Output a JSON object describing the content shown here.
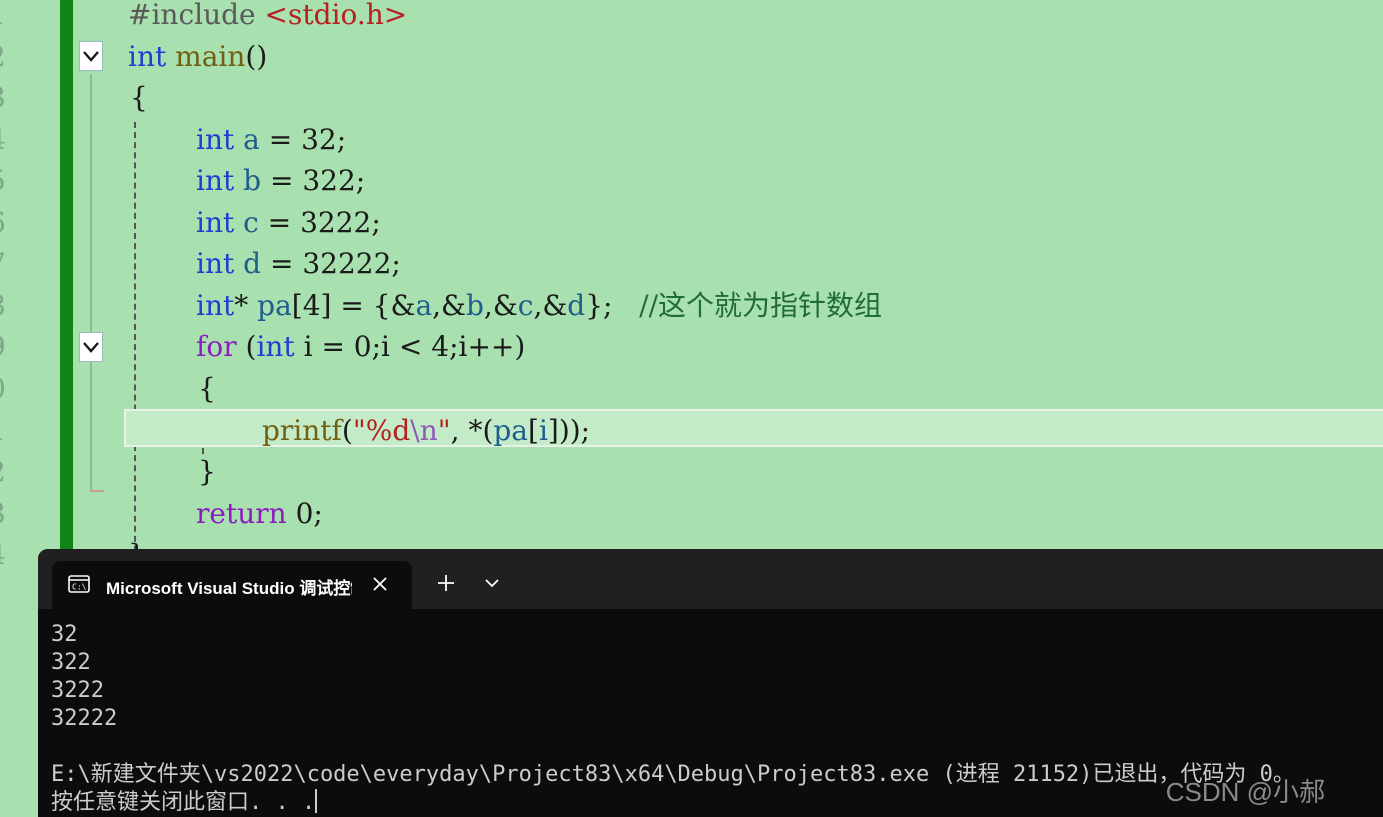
{
  "editor": {
    "line_numbers": [
      "1",
      "2",
      "3",
      "4",
      "5",
      "6",
      "7",
      "8",
      "9",
      "0",
      "1",
      "2",
      "3",
      "4"
    ],
    "code": {
      "l1": {
        "include": "#include ",
        "header": "<stdio.h>"
      },
      "l2": {
        "type": "int",
        "name": "main",
        "parens": "()"
      },
      "l3": {
        "brace": "{"
      },
      "l4": {
        "type": "int",
        "var": "a",
        "rest": " = 32;"
      },
      "l5": {
        "type": "int",
        "var": "b",
        "rest": " = 322;"
      },
      "l6": {
        "type": "int",
        "var": "c",
        "rest": " = 3222;"
      },
      "l7": {
        "type": "int",
        "var": "d",
        "rest": " = 32222;"
      },
      "l8": {
        "type": "int",
        "p1": "* ",
        "var": "pa",
        "p2": "[4] = {&",
        "a": "a",
        "p3": ",&",
        "b": "b",
        "p4": ",&",
        "c": "c",
        "p5": ",&",
        "d": "d",
        "p6": "};   ",
        "comment": "//这个就为指针数组"
      },
      "l9": {
        "kw": "for",
        "p1": " (",
        "type": "int",
        "p2": " i = 0;i < 4;i++)"
      },
      "l10": {
        "brace": "{"
      },
      "l11": {
        "fn": "printf",
        "p1": "(",
        "str1": "\"%d",
        "esc": "\\n",
        "str2": "\"",
        "p2": ", *(",
        "var": "pa",
        "p3": "[",
        "i": "i",
        "p4": "]));"
      },
      "l12": {
        "brace": "}"
      },
      "l13": {
        "kw": "return",
        "rest": " 0;"
      },
      "l14": {
        "brace": "}"
      }
    }
  },
  "terminal": {
    "tab_title": "Microsoft Visual Studio 调试控制台",
    "output_lines": [
      "32",
      "322",
      "3222",
      "32222"
    ],
    "exit_message": "E:\\新建文件夹\\vs2022\\code\\everyday\\Project83\\x64\\Debug\\Project83.exe (进程 21152)已退出，代码为 0。",
    "press_key": "按任意键关闭此窗口. . ."
  },
  "watermark": "CSDN @小郝"
}
